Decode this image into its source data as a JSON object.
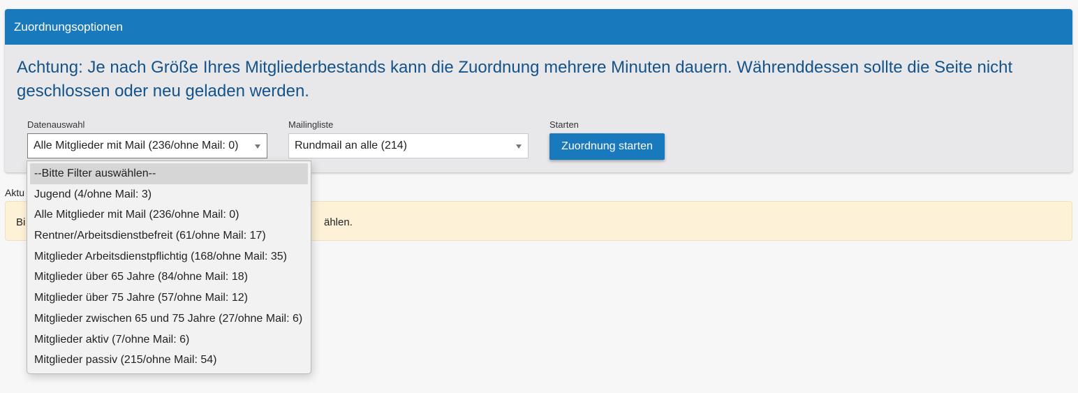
{
  "panel": {
    "title": "Zuordnungsoptionen",
    "warning": "Achtung: Je nach Größe Ihres Mitgliederbestands kann die Zuordnung mehrere Minuten dauern. Währenddessen sollte die Seite nicht geschlossen oder neu geladen werden."
  },
  "data_selection": {
    "label": "Datenauswahl",
    "selected": "Alle Mitglieder mit Mail (236/ohne Mail: 0)",
    "options": [
      "--Bitte Filter auswählen--",
      "Jugend (4/ohne Mail: 3)",
      "Alle Mitglieder mit Mail (236/ohne Mail: 0)",
      "Rentner/Arbeitsdienstbefreit (61/ohne Mail: 17)",
      "Mitglieder Arbeitsdienstpflichtig (168/ohne Mail: 35)",
      "Mitglieder über 65 Jahre (84/ohne Mail: 18)",
      "Mitglieder über 75 Jahre (57/ohne Mail: 12)",
      "Mitglieder zwischen 65 und 75 Jahre (27/ohne Mail: 6)",
      "Mitglieder aktiv (7/ohne Mail: 6)",
      "Mitglieder passiv (215/ohne Mail: 54)"
    ],
    "highlighted_option": "--Bitte Filter auswählen--"
  },
  "mailing_list": {
    "label": "Mailingliste",
    "selected": "Rundmail an alle (214)"
  },
  "start": {
    "label": "Starten",
    "button_label": "Zuordnung starten"
  },
  "current": {
    "label_visible": "Aktu",
    "alert_visible_start": "Bi",
    "alert_visible_end": "ählen."
  },
  "colors": {
    "header_blue": "#1979bd",
    "warning_text": "#14538a",
    "alert_background": "#fdf1d8"
  },
  "icons": {
    "select_caret": "caret-down-icon"
  }
}
